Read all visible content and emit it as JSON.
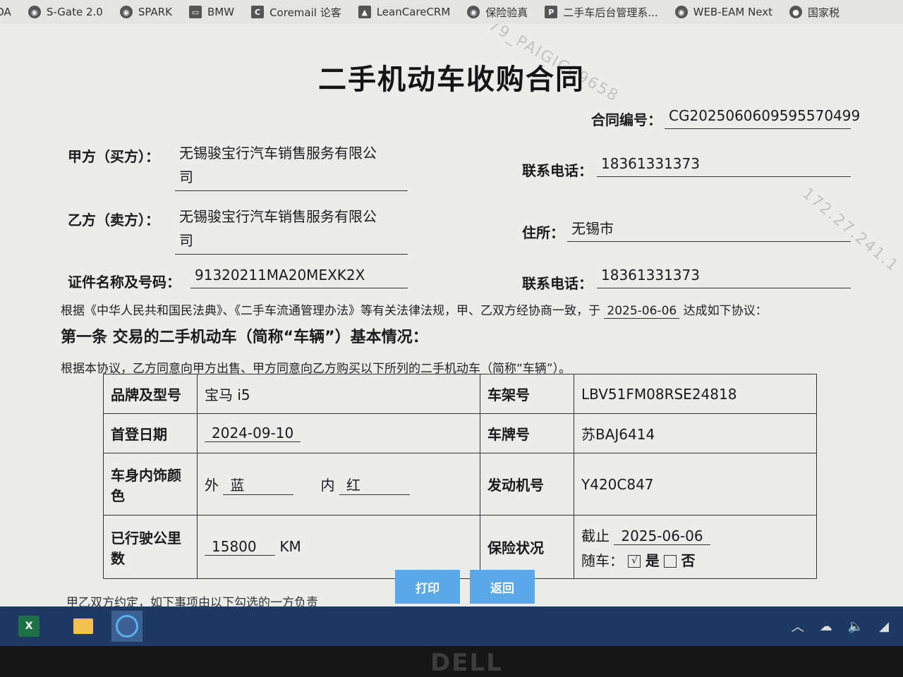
{
  "bookmarks": [
    {
      "label": "OA",
      "icon": "globe-icon"
    },
    {
      "label": "S-Gate 2.0",
      "icon": "globe-icon"
    },
    {
      "label": "SPARK",
      "icon": "globe-icon"
    },
    {
      "label": "BMW",
      "icon": "folder-icon"
    },
    {
      "label": "Coremail 论客",
      "icon": "mail-icon"
    },
    {
      "label": "LeanCareCRM",
      "icon": "chart-icon"
    },
    {
      "label": "保险验真",
      "icon": "globe-icon"
    },
    {
      "label": "二手车后台管理系...",
      "icon": "p-icon"
    },
    {
      "label": "WEB-EAM Next",
      "icon": "globe-icon"
    },
    {
      "label": "国家税",
      "icon": "bookmark-icon"
    }
  ],
  "watermark": {
    "line1": "79_PAIGIC09658",
    "line2": "172.27.241.1"
  },
  "doc": {
    "title": "二手机动车收购合同",
    "contract_no_label": "合同编号：",
    "contract_no": "CG2025060609595570499",
    "party_a_label": "甲方（买方）：",
    "party_a_line1": "无锡骏宝行汽车销售服务有限公",
    "party_a_line2": "司",
    "phone_label_a": "联系电话：",
    "phone_a": "18361331373",
    "party_b_label": "乙方（卖方）：",
    "party_b_line1": "无锡骏宝行汽车销售服务有限公",
    "party_b_line2": "司",
    "address_label": "住所：",
    "address": "无锡市",
    "id_label": "证件名称及号码：",
    "id_value": "91320211MA20MEXK2X",
    "phone_label_b": "联系电话：",
    "phone_b": "18361331373",
    "intro_pre": "根据《中华人民共和国民法典》、《二手车流通管理办法》等有关法律法规，甲、乙双方经协商一致，于",
    "intro_date": "2025-06-06",
    "intro_post": "达成如下协议：",
    "article1_title": "第一条 交易的二手机动车（简称“车辆”）基本情况：",
    "article1_text": "根据本协议，乙方同意向甲方出售、甲方同意向乙方购买以下所列的二手机动车（简称“车辆”）。",
    "footer_text": "甲乙双方约定，如下事项由以下勾选的一方负责"
  },
  "vehicle": {
    "brand_label": "品牌及型号",
    "brand": "宝马 i5",
    "vin_label": "车架号",
    "vin": "LBV51FM08RSE24818",
    "reg_date_label": "首登日期",
    "reg_date": "2024-09-10",
    "plate_label": "车牌号",
    "plate": "苏BAJ6414",
    "color_label": "车身内饰颜色",
    "color_out_label": "外",
    "color_out": "蓝",
    "color_in_label": "内",
    "color_in": "红",
    "engine_label": "发动机号",
    "engine": "Y420C847",
    "mileage_label": "已行驶公里数",
    "mileage": "15800",
    "mileage_unit": "KM",
    "insurance_label": "保险状况",
    "ins_until_label": "截止",
    "ins_until": "2025-06-06",
    "ins_with_label": "随车：",
    "ins_yes": "是",
    "ins_no": "否",
    "ins_check": "√"
  },
  "buttons": {
    "print": "打印",
    "back": "返回"
  },
  "taskbar": {
    "apps": [
      "excel-icon",
      "file-explorer-icon",
      "browser-icon"
    ]
  },
  "bezel_logo": "DELL"
}
